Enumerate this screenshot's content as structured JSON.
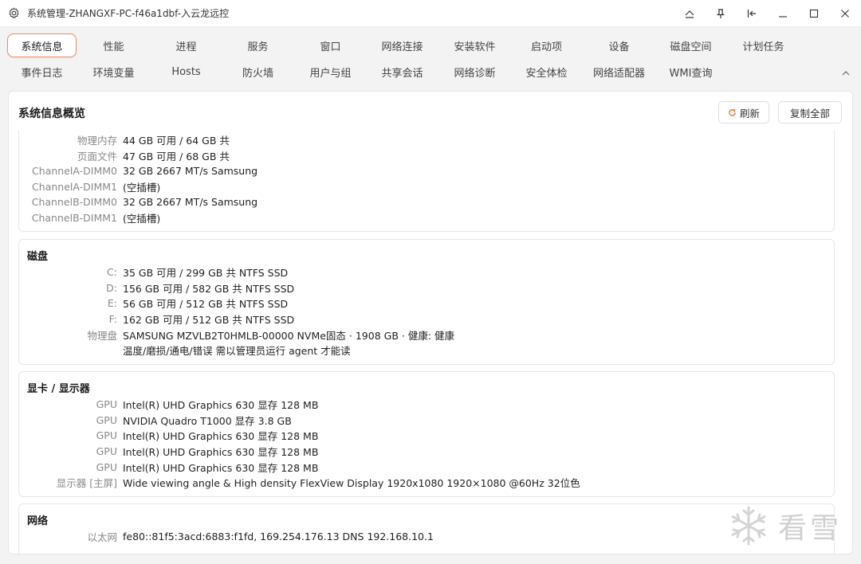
{
  "window": {
    "title": "系统管理-ZHANGXF-PC-f46a1dbf-入云龙远控"
  },
  "tabs_row1": [
    "系统信息",
    "性能",
    "进程",
    "服务",
    "窗口",
    "网络连接",
    "安装软件",
    "启动项",
    "设备",
    "磁盘空间",
    "计划任务"
  ],
  "tabs_row2": [
    "事件日志",
    "环境变量",
    "Hosts",
    "防火墙",
    "用户与组",
    "共享会话",
    "网络诊断",
    "安全体检",
    "网络适配器",
    "WMI查询"
  ],
  "active_tab": "系统信息",
  "panel": {
    "title": "系统信息概览",
    "refresh_label": "刷新",
    "copy_label": "复制全部"
  },
  "memory": {
    "rows": [
      {
        "label": "物理内存",
        "value": "44 GB 可用 / 64 GB 共"
      },
      {
        "label": "页面文件",
        "value": "47 GB 可用 / 68 GB 共"
      },
      {
        "label": "ChannelA-DIMM0",
        "value": "32 GB  2667 MT/s  Samsung"
      },
      {
        "label": "ChannelA-DIMM1",
        "value": "(空插槽)"
      },
      {
        "label": "ChannelB-DIMM0",
        "value": "32 GB  2667 MT/s  Samsung"
      },
      {
        "label": "ChannelB-DIMM1",
        "value": "(空插槽)"
      }
    ]
  },
  "disk": {
    "title": "磁盘",
    "rows": [
      {
        "label": "C:",
        "value": "35 GB 可用 / 299 GB 共  NTFS  SSD"
      },
      {
        "label": "D:",
        "value": "156 GB 可用 / 582 GB 共  NTFS  SSD"
      },
      {
        "label": "E:",
        "value": "56 GB 可用 / 512 GB 共  NTFS  SSD"
      },
      {
        "label": "F:",
        "value": "162 GB 可用 / 512 GB 共  NTFS  SSD"
      },
      {
        "label": "物理盘",
        "value": "SAMSUNG MZVLB2T0HMLB-00000   NVMe固态 · 1908 GB · 健康: 健康"
      },
      {
        "label": "",
        "value": "温度/磨损/通电/错误 需以管理员运行 agent 才能读"
      }
    ]
  },
  "gpu": {
    "title": "显卡 / 显示器",
    "rows": [
      {
        "label": "GPU",
        "value": "Intel(R) UHD Graphics 630  显存 128 MB"
      },
      {
        "label": "GPU",
        "value": "NVIDIA Quadro T1000  显存 3.8 GB"
      },
      {
        "label": "GPU",
        "value": "Intel(R) UHD Graphics 630  显存 128 MB"
      },
      {
        "label": "GPU",
        "value": "Intel(R) UHD Graphics 630  显存 128 MB"
      },
      {
        "label": "GPU",
        "value": "Intel(R) UHD Graphics 630  显存 128 MB"
      },
      {
        "label": "显示器 [主屏]",
        "value": "Wide viewing angle & High density FlexView Display 1920x1080   1920×1080 @60Hz  32位色"
      }
    ]
  },
  "network": {
    "title": "网络",
    "rows": [
      {
        "label": "以太网",
        "value": "fe80::81f5:3acd:6883:f1fd, 169.254.176.13   DNS 192.168.10.1"
      }
    ]
  },
  "watermark": {
    "text": "看雪"
  },
  "colors": {
    "accent": "#f08a5d",
    "label_gray": "#888888"
  }
}
